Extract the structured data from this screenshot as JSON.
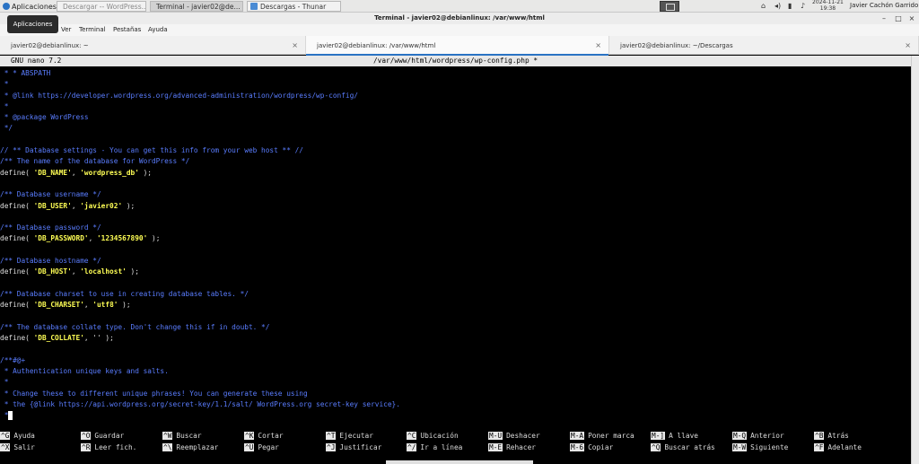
{
  "panel": {
    "apps_label": "Aplicaciones",
    "tasks": [
      {
        "label": "Descargar -- WordPress....",
        "state": "inactive"
      },
      {
        "label": "Terminal - javier02@de...",
        "state": "active"
      },
      {
        "label": "Descargas - Thunar",
        "state": "normal"
      }
    ],
    "clock_date": "2024-11-21",
    "clock_time": "19:38",
    "user": "Javier Cachón Garrido"
  },
  "tooltip": "Aplicaciones",
  "window": {
    "title": "Terminal - javier02@debianlinux: /var/www/html",
    "menu": [
      "Ver",
      "Terminal",
      "Pestañas",
      "Ayuda"
    ],
    "tabs": [
      {
        "label": "javier02@debianlinux: ~",
        "active": false
      },
      {
        "label": "javier02@debianlinux: /var/www/html",
        "active": true
      },
      {
        "label": "javier02@debianlinux: ~/Descargas",
        "active": false
      }
    ]
  },
  "nano": {
    "version": "GNU nano 7.2",
    "filename": "/var/www/html/wordpress/wp-config.php *",
    "lines": [
      [
        {
          "t": " * * ABSPATH",
          "c": "c"
        }
      ],
      [
        {
          "t": " *",
          "c": "c"
        }
      ],
      [
        {
          "t": " * @link https://developer.wordpress.org/advanced-administration/wordpress/wp-config/",
          "c": "c"
        }
      ],
      [
        {
          "t": " *",
          "c": "c"
        }
      ],
      [
        {
          "t": " * @package WordPress",
          "c": "c"
        }
      ],
      [
        {
          "t": " */",
          "c": "c"
        }
      ],
      [
        {
          "t": "",
          "c": ""
        }
      ],
      [
        {
          "t": "// ** Database settings - You can get this info from your web host ** //",
          "c": "c"
        }
      ],
      [
        {
          "t": "/** The name of the database for WordPress */",
          "c": "c"
        }
      ],
      [
        {
          "t": "define( ",
          "c": ""
        },
        {
          "t": "'DB_NAME'",
          "c": "s"
        },
        {
          "t": ", ",
          "c": ""
        },
        {
          "t": "'wordpress_db'",
          "c": "s"
        },
        {
          "t": " );",
          "c": ""
        }
      ],
      [
        {
          "t": "",
          "c": ""
        }
      ],
      [
        {
          "t": "/** Database username */",
          "c": "c"
        }
      ],
      [
        {
          "t": "define( ",
          "c": ""
        },
        {
          "t": "'DB_USER'",
          "c": "s"
        },
        {
          "t": ", ",
          "c": ""
        },
        {
          "t": "'javier02'",
          "c": "s"
        },
        {
          "t": " );",
          "c": ""
        }
      ],
      [
        {
          "t": "",
          "c": ""
        }
      ],
      [
        {
          "t": "/** Database password */",
          "c": "c"
        }
      ],
      [
        {
          "t": "define( ",
          "c": ""
        },
        {
          "t": "'DB_PASSWORD'",
          "c": "s"
        },
        {
          "t": ", ",
          "c": ""
        },
        {
          "t": "'1234567890'",
          "c": "s"
        },
        {
          "t": " );",
          "c": ""
        }
      ],
      [
        {
          "t": "",
          "c": ""
        }
      ],
      [
        {
          "t": "/** Database hostname */",
          "c": "c"
        }
      ],
      [
        {
          "t": "define( ",
          "c": ""
        },
        {
          "t": "'DB_HOST'",
          "c": "s"
        },
        {
          "t": ", ",
          "c": ""
        },
        {
          "t": "'localhost'",
          "c": "s"
        },
        {
          "t": " );",
          "c": ""
        }
      ],
      [
        {
          "t": "",
          "c": ""
        }
      ],
      [
        {
          "t": "/** Database charset to use in creating database tables. */",
          "c": "c"
        }
      ],
      [
        {
          "t": "define( ",
          "c": ""
        },
        {
          "t": "'DB_CHARSET'",
          "c": "s"
        },
        {
          "t": ", ",
          "c": ""
        },
        {
          "t": "'utf8'",
          "c": "s"
        },
        {
          "t": " );",
          "c": ""
        }
      ],
      [
        {
          "t": "",
          "c": ""
        }
      ],
      [
        {
          "t": "/** The database collate type. Don't change this if in doubt. */",
          "c": "c"
        }
      ],
      [
        {
          "t": "define( ",
          "c": ""
        },
        {
          "t": "'DB_COLLATE'",
          "c": "s"
        },
        {
          "t": ", '' );",
          "c": ""
        }
      ],
      [
        {
          "t": "",
          "c": ""
        }
      ],
      [
        {
          "t": "/**#@+",
          "c": "c"
        }
      ],
      [
        {
          "t": " * Authentication unique keys and salts.",
          "c": "c"
        }
      ],
      [
        {
          "t": " *",
          "c": "c"
        }
      ],
      [
        {
          "t": " * Change these to different unique phrases! You can generate these using",
          "c": "c"
        }
      ],
      [
        {
          "t": " * the {@link https://api.wordpress.org/secret-key/1.1/salt/ WordPress.org secret-key service}.",
          "c": "c"
        }
      ],
      [
        {
          "t": " *",
          "c": "c"
        },
        {
          "t": "",
          "c": "cursor"
        }
      ]
    ],
    "shortcuts": [
      [
        {
          "k": "^G",
          "d": "Ayuda"
        },
        {
          "k": "^O",
          "d": "Guardar"
        },
        {
          "k": "^W",
          "d": "Buscar"
        },
        {
          "k": "^K",
          "d": "Cortar"
        },
        {
          "k": "^T",
          "d": "Ejecutar"
        },
        {
          "k": "^C",
          "d": "Ubicación"
        },
        {
          "k": "M-U",
          "d": "Deshacer"
        },
        {
          "k": "M-A",
          "d": "Poner marca"
        },
        {
          "k": "M-]",
          "d": "A llave"
        },
        {
          "k": "M-Q",
          "d": "Anterior"
        },
        {
          "k": "^B",
          "d": "Atrás"
        }
      ],
      [
        {
          "k": "^X",
          "d": "Salir"
        },
        {
          "k": "^R",
          "d": "Leer fich."
        },
        {
          "k": "^\\",
          "d": "Reemplazar"
        },
        {
          "k": "^U",
          "d": "Pegar"
        },
        {
          "k": "^J",
          "d": "Justificar"
        },
        {
          "k": "^/",
          "d": "Ir a línea"
        },
        {
          "k": "M-E",
          "d": "Rehacer"
        },
        {
          "k": "M-6",
          "d": "Copiar"
        },
        {
          "k": "^Q",
          "d": "Buscar atrás"
        },
        {
          "k": "M-W",
          "d": "Siguiente"
        },
        {
          "k": "^F",
          "d": "Adelante"
        }
      ]
    ]
  }
}
